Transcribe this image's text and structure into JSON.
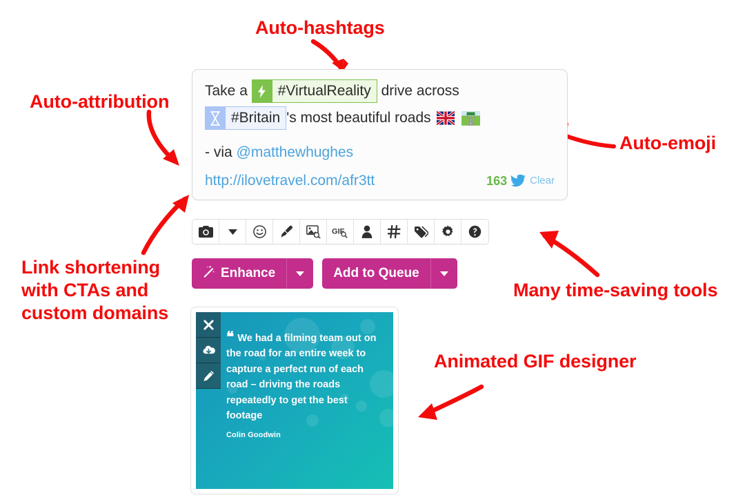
{
  "annotations": {
    "hashtags": "Auto-hashtags",
    "attribution": "Auto-attribution",
    "emoji": "Auto-emoji",
    "link": "Link shortening\nwith CTAs and\ncustom domains",
    "tools": "Many time-saving tools",
    "gif": "Animated GIF designer",
    "color": "#f30c0c"
  },
  "composer": {
    "text_before_hashtag": "Take a ",
    "hashtag1": "#VirtualReality",
    "hashtag1_badge": "lightning-bolt-icon",
    "hashtag1_color": "#7dc24b",
    "text_after_hashtag": " drive across",
    "hashtag2": "#Britain",
    "hashtag2_badge": "hourglass-icon",
    "hashtag2_color": "#a9c4f5",
    "text_after_hashtag2": "'s most beautiful roads",
    "emoji1": "uk-flag-emoji",
    "emoji2": "motorway-emoji",
    "via_prefix": "- via ",
    "mention": "@matthewhughes",
    "short_url": "http://ilovetravel.com/afr3tt",
    "char_count": "163",
    "network_icon": "twitter-bird-icon",
    "count_color": "#69b949",
    "clear_label": "Clear"
  },
  "toolbar": {
    "buttons": [
      {
        "name": "camera-icon",
        "label": ""
      },
      {
        "name": "chevron-down-icon",
        "label": ""
      },
      {
        "name": "smiley-icon",
        "label": ""
      },
      {
        "name": "paintbrush-icon",
        "label": ""
      },
      {
        "name": "image-search-icon",
        "label": ""
      },
      {
        "name": "gif-search-icon",
        "label": "GIF"
      },
      {
        "name": "person-icon",
        "label": ""
      },
      {
        "name": "hashtag-icon",
        "label": ""
      },
      {
        "name": "tag-icon",
        "label": ""
      },
      {
        "name": "gear-icon",
        "label": ""
      },
      {
        "name": "help-icon",
        "label": ""
      }
    ]
  },
  "actions": {
    "enhance_label": "Enhance",
    "enhance_icon": "magic-wand-icon",
    "queue_label": "Add to Queue",
    "button_color": "#c32d8c"
  },
  "gif_designer": {
    "tools": [
      {
        "name": "close-icon"
      },
      {
        "name": "cloud-download-icon"
      },
      {
        "name": "pencil-icon"
      }
    ],
    "quote": "We had a filming team out on the road for an entire week to capture a perfect run of each road – driving the roads repeatedly to get the best footage",
    "author": "Colin Goodwin",
    "gradient_from": "#1695b8",
    "gradient_to": "#16bfb4"
  }
}
